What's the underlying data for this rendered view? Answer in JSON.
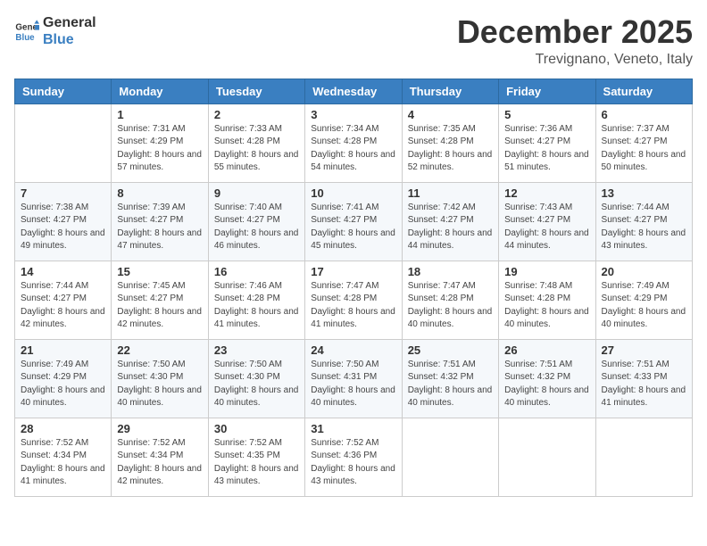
{
  "header": {
    "logo_line1": "General",
    "logo_line2": "Blue",
    "month_title": "December 2025",
    "location": "Trevignano, Veneto, Italy"
  },
  "weekdays": [
    "Sunday",
    "Monday",
    "Tuesday",
    "Wednesday",
    "Thursday",
    "Friday",
    "Saturday"
  ],
  "weeks": [
    [
      {
        "day": "",
        "sunrise": "",
        "sunset": "",
        "daylight": ""
      },
      {
        "day": "1",
        "sunrise": "Sunrise: 7:31 AM",
        "sunset": "Sunset: 4:29 PM",
        "daylight": "Daylight: 8 hours and 57 minutes."
      },
      {
        "day": "2",
        "sunrise": "Sunrise: 7:33 AM",
        "sunset": "Sunset: 4:28 PM",
        "daylight": "Daylight: 8 hours and 55 minutes."
      },
      {
        "day": "3",
        "sunrise": "Sunrise: 7:34 AM",
        "sunset": "Sunset: 4:28 PM",
        "daylight": "Daylight: 8 hours and 54 minutes."
      },
      {
        "day": "4",
        "sunrise": "Sunrise: 7:35 AM",
        "sunset": "Sunset: 4:28 PM",
        "daylight": "Daylight: 8 hours and 52 minutes."
      },
      {
        "day": "5",
        "sunrise": "Sunrise: 7:36 AM",
        "sunset": "Sunset: 4:27 PM",
        "daylight": "Daylight: 8 hours and 51 minutes."
      },
      {
        "day": "6",
        "sunrise": "Sunrise: 7:37 AM",
        "sunset": "Sunset: 4:27 PM",
        "daylight": "Daylight: 8 hours and 50 minutes."
      }
    ],
    [
      {
        "day": "7",
        "sunrise": "Sunrise: 7:38 AM",
        "sunset": "Sunset: 4:27 PM",
        "daylight": "Daylight: 8 hours and 49 minutes."
      },
      {
        "day": "8",
        "sunrise": "Sunrise: 7:39 AM",
        "sunset": "Sunset: 4:27 PM",
        "daylight": "Daylight: 8 hours and 47 minutes."
      },
      {
        "day": "9",
        "sunrise": "Sunrise: 7:40 AM",
        "sunset": "Sunset: 4:27 PM",
        "daylight": "Daylight: 8 hours and 46 minutes."
      },
      {
        "day": "10",
        "sunrise": "Sunrise: 7:41 AM",
        "sunset": "Sunset: 4:27 PM",
        "daylight": "Daylight: 8 hours and 45 minutes."
      },
      {
        "day": "11",
        "sunrise": "Sunrise: 7:42 AM",
        "sunset": "Sunset: 4:27 PM",
        "daylight": "Daylight: 8 hours and 44 minutes."
      },
      {
        "day": "12",
        "sunrise": "Sunrise: 7:43 AM",
        "sunset": "Sunset: 4:27 PM",
        "daylight": "Daylight: 8 hours and 44 minutes."
      },
      {
        "day": "13",
        "sunrise": "Sunrise: 7:44 AM",
        "sunset": "Sunset: 4:27 PM",
        "daylight": "Daylight: 8 hours and 43 minutes."
      }
    ],
    [
      {
        "day": "14",
        "sunrise": "Sunrise: 7:44 AM",
        "sunset": "Sunset: 4:27 PM",
        "daylight": "Daylight: 8 hours and 42 minutes."
      },
      {
        "day": "15",
        "sunrise": "Sunrise: 7:45 AM",
        "sunset": "Sunset: 4:27 PM",
        "daylight": "Daylight: 8 hours and 42 minutes."
      },
      {
        "day": "16",
        "sunrise": "Sunrise: 7:46 AM",
        "sunset": "Sunset: 4:28 PM",
        "daylight": "Daylight: 8 hours and 41 minutes."
      },
      {
        "day": "17",
        "sunrise": "Sunrise: 7:47 AM",
        "sunset": "Sunset: 4:28 PM",
        "daylight": "Daylight: 8 hours and 41 minutes."
      },
      {
        "day": "18",
        "sunrise": "Sunrise: 7:47 AM",
        "sunset": "Sunset: 4:28 PM",
        "daylight": "Daylight: 8 hours and 40 minutes."
      },
      {
        "day": "19",
        "sunrise": "Sunrise: 7:48 AM",
        "sunset": "Sunset: 4:28 PM",
        "daylight": "Daylight: 8 hours and 40 minutes."
      },
      {
        "day": "20",
        "sunrise": "Sunrise: 7:49 AM",
        "sunset": "Sunset: 4:29 PM",
        "daylight": "Daylight: 8 hours and 40 minutes."
      }
    ],
    [
      {
        "day": "21",
        "sunrise": "Sunrise: 7:49 AM",
        "sunset": "Sunset: 4:29 PM",
        "daylight": "Daylight: 8 hours and 40 minutes."
      },
      {
        "day": "22",
        "sunrise": "Sunrise: 7:50 AM",
        "sunset": "Sunset: 4:30 PM",
        "daylight": "Daylight: 8 hours and 40 minutes."
      },
      {
        "day": "23",
        "sunrise": "Sunrise: 7:50 AM",
        "sunset": "Sunset: 4:30 PM",
        "daylight": "Daylight: 8 hours and 40 minutes."
      },
      {
        "day": "24",
        "sunrise": "Sunrise: 7:50 AM",
        "sunset": "Sunset: 4:31 PM",
        "daylight": "Daylight: 8 hours and 40 minutes."
      },
      {
        "day": "25",
        "sunrise": "Sunrise: 7:51 AM",
        "sunset": "Sunset: 4:32 PM",
        "daylight": "Daylight: 8 hours and 40 minutes."
      },
      {
        "day": "26",
        "sunrise": "Sunrise: 7:51 AM",
        "sunset": "Sunset: 4:32 PM",
        "daylight": "Daylight: 8 hours and 40 minutes."
      },
      {
        "day": "27",
        "sunrise": "Sunrise: 7:51 AM",
        "sunset": "Sunset: 4:33 PM",
        "daylight": "Daylight: 8 hours and 41 minutes."
      }
    ],
    [
      {
        "day": "28",
        "sunrise": "Sunrise: 7:52 AM",
        "sunset": "Sunset: 4:34 PM",
        "daylight": "Daylight: 8 hours and 41 minutes."
      },
      {
        "day": "29",
        "sunrise": "Sunrise: 7:52 AM",
        "sunset": "Sunset: 4:34 PM",
        "daylight": "Daylight: 8 hours and 42 minutes."
      },
      {
        "day": "30",
        "sunrise": "Sunrise: 7:52 AM",
        "sunset": "Sunset: 4:35 PM",
        "daylight": "Daylight: 8 hours and 43 minutes."
      },
      {
        "day": "31",
        "sunrise": "Sunrise: 7:52 AM",
        "sunset": "Sunset: 4:36 PM",
        "daylight": "Daylight: 8 hours and 43 minutes."
      },
      {
        "day": "",
        "sunrise": "",
        "sunset": "",
        "daylight": ""
      },
      {
        "day": "",
        "sunrise": "",
        "sunset": "",
        "daylight": ""
      },
      {
        "day": "",
        "sunrise": "",
        "sunset": "",
        "daylight": ""
      }
    ]
  ]
}
